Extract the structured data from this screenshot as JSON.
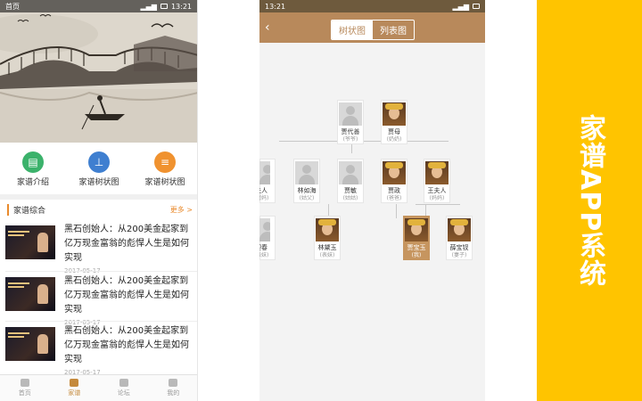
{
  "phone1": {
    "status_time": "首页",
    "quick": [
      {
        "label": "家谱介绍",
        "color": "#3bb26b",
        "icon": "document-icon"
      },
      {
        "label": "家谱树状图",
        "color": "#3f7fd0",
        "icon": "tree-icon"
      },
      {
        "label": "家谱树状图",
        "color": "#f0922f",
        "icon": "list-icon"
      }
    ],
    "section_title": "家谱综合",
    "section_more": "更多 >",
    "news": [
      {
        "title": "黑石创始人：从200美金起家到亿万现金富翁的彪悍人生是如何实现",
        "date": "2017-05-17"
      },
      {
        "title": "黑石创始人：从200美金起家到亿万现金富翁的彪悍人生是如何实现",
        "date": "2017-05-17"
      },
      {
        "title": "黑石创始人：从200美金起家到亿万现金富翁的彪悍人生是如何实现",
        "date": "2017-05-17"
      }
    ],
    "tabs": [
      {
        "label": "首页",
        "active": false
      },
      {
        "label": "家谱",
        "active": true
      },
      {
        "label": "论坛",
        "active": false
      },
      {
        "label": "我的",
        "active": false
      }
    ]
  },
  "phone2": {
    "status_time": "13:21",
    "seg_tree": "树状图",
    "seg_list": "列表图",
    "members": [
      {
        "name": "贾代善",
        "role": "(爷爷)",
        "photo": false
      },
      {
        "name": "贾母",
        "role": "(奶奶)",
        "photo": true
      },
      {
        "name": "夫人",
        "role": "(舅妈)",
        "photo": false
      },
      {
        "name": "林如海",
        "role": "(姑父)",
        "photo": false
      },
      {
        "name": "贾敏",
        "role": "(姑姑)",
        "photo": false
      },
      {
        "name": "贾政",
        "role": "(爸爸)",
        "photo": true
      },
      {
        "name": "王夫人",
        "role": "(妈妈)",
        "photo": true
      },
      {
        "name": "迎春",
        "role": "(表妹)",
        "photo": false
      },
      {
        "name": "林黛玉",
        "role": "(表妹)",
        "photo": true
      },
      {
        "name": "贾宝玉",
        "role": "(我)",
        "photo": true
      },
      {
        "name": "薛宝钗",
        "role": "(妻子)",
        "photo": true
      }
    ]
  },
  "phone1_status": "首页",
  "phone1_time": "13:21",
  "promo": {
    "title": "家谱APP系统",
    "color": "#ffc400"
  }
}
